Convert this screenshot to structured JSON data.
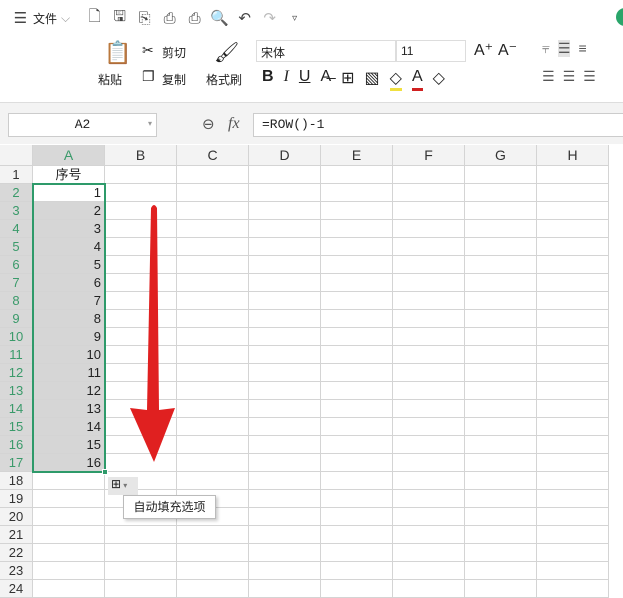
{
  "quick_access": {
    "menu_label": "文件",
    "icons": [
      "new-icon",
      "save-icon",
      "export-icon",
      "print-icon",
      "print-preview-icon",
      "find-icon",
      "undo-icon",
      "redo-icon",
      "customize-icon"
    ]
  },
  "ribbon": {
    "paste": "粘贴",
    "cut": "剪切",
    "copy": "复制",
    "format_painter": "格式刷",
    "font_name": "宋体",
    "font_size": "11"
  },
  "formula_bar": {
    "name_box": "A2",
    "fx": "fx",
    "formula": "=ROW()-1"
  },
  "sheet": {
    "columns": [
      "A",
      "B",
      "C",
      "D",
      "E",
      "F",
      "G",
      "H"
    ],
    "header_cell": "序号",
    "values": [
      "1",
      "2",
      "3",
      "4",
      "5",
      "6",
      "7",
      "8",
      "9",
      "10",
      "11",
      "12",
      "13",
      "14",
      "15",
      "16"
    ],
    "row_count": 24
  },
  "fill_options_tooltip": "自动填充选项",
  "colors": {
    "selection": "#2e9a6a",
    "arrow": "#e02020"
  }
}
